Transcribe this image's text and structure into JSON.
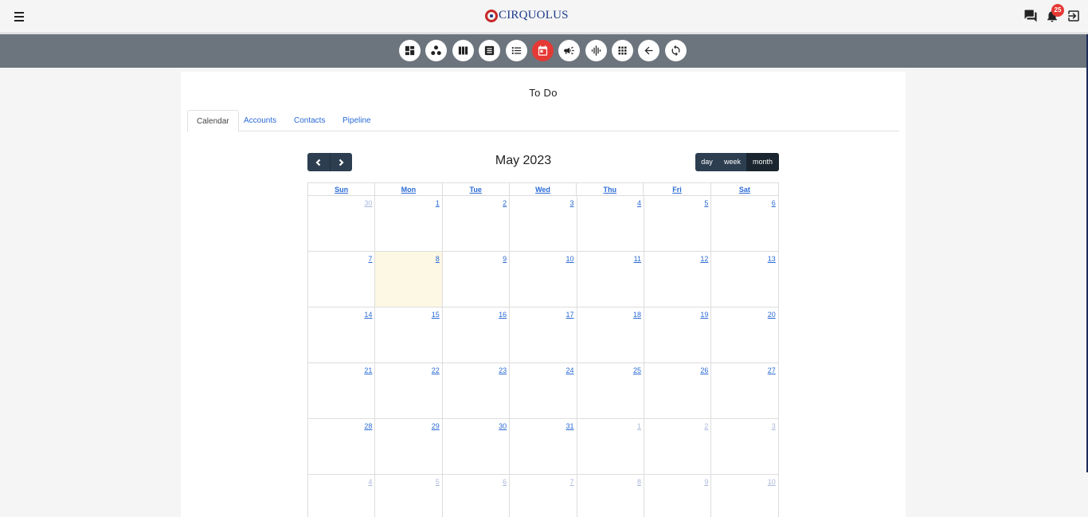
{
  "app": {
    "brand": "CIRQUOLUS",
    "notification_count": "25"
  },
  "page": {
    "title": "To Do"
  },
  "tabs": [
    {
      "label": "Calendar",
      "active": true
    },
    {
      "label": "Accounts",
      "active": false
    },
    {
      "label": "Contacts",
      "active": false
    },
    {
      "label": "Pipeline",
      "active": false
    }
  ],
  "toolbar_icons": [
    "dashboard-icon",
    "cluster-icon",
    "columns-icon",
    "document-list-icon",
    "bullet-list-icon",
    "calendar-icon",
    "megaphone-icon",
    "audio-wave-icon",
    "apps-grid-icon",
    "arrow-left-icon",
    "refresh-icon"
  ],
  "calendar": {
    "month_title": "May 2023",
    "views": {
      "day": "day",
      "week": "week",
      "month": "month"
    },
    "active_view": "month",
    "weekdays": [
      "Sun",
      "Mon",
      "Tue",
      "Wed",
      "Thu",
      "Fri",
      "Sat"
    ],
    "weeks": [
      [
        "30",
        "1",
        "2",
        "3",
        "4",
        "5",
        "6"
      ],
      [
        "7",
        "8",
        "9",
        "10",
        "11",
        "12",
        "13"
      ],
      [
        "14",
        "15",
        "16",
        "17",
        "18",
        "19",
        "20"
      ],
      [
        "21",
        "22",
        "23",
        "24",
        "25",
        "26",
        "27"
      ],
      [
        "28",
        "29",
        "30",
        "31",
        "1",
        "2",
        "3"
      ],
      [
        "4",
        "5",
        "6",
        "7",
        "8",
        "9",
        "10"
      ]
    ]
  },
  "colors": {
    "accent_red": "#e53935",
    "toolbar_bg": "#6c757d",
    "link_blue": "#2a6ad6",
    "today_bg": "#fcf8e3",
    "nav_dark": "#2c3e50"
  }
}
